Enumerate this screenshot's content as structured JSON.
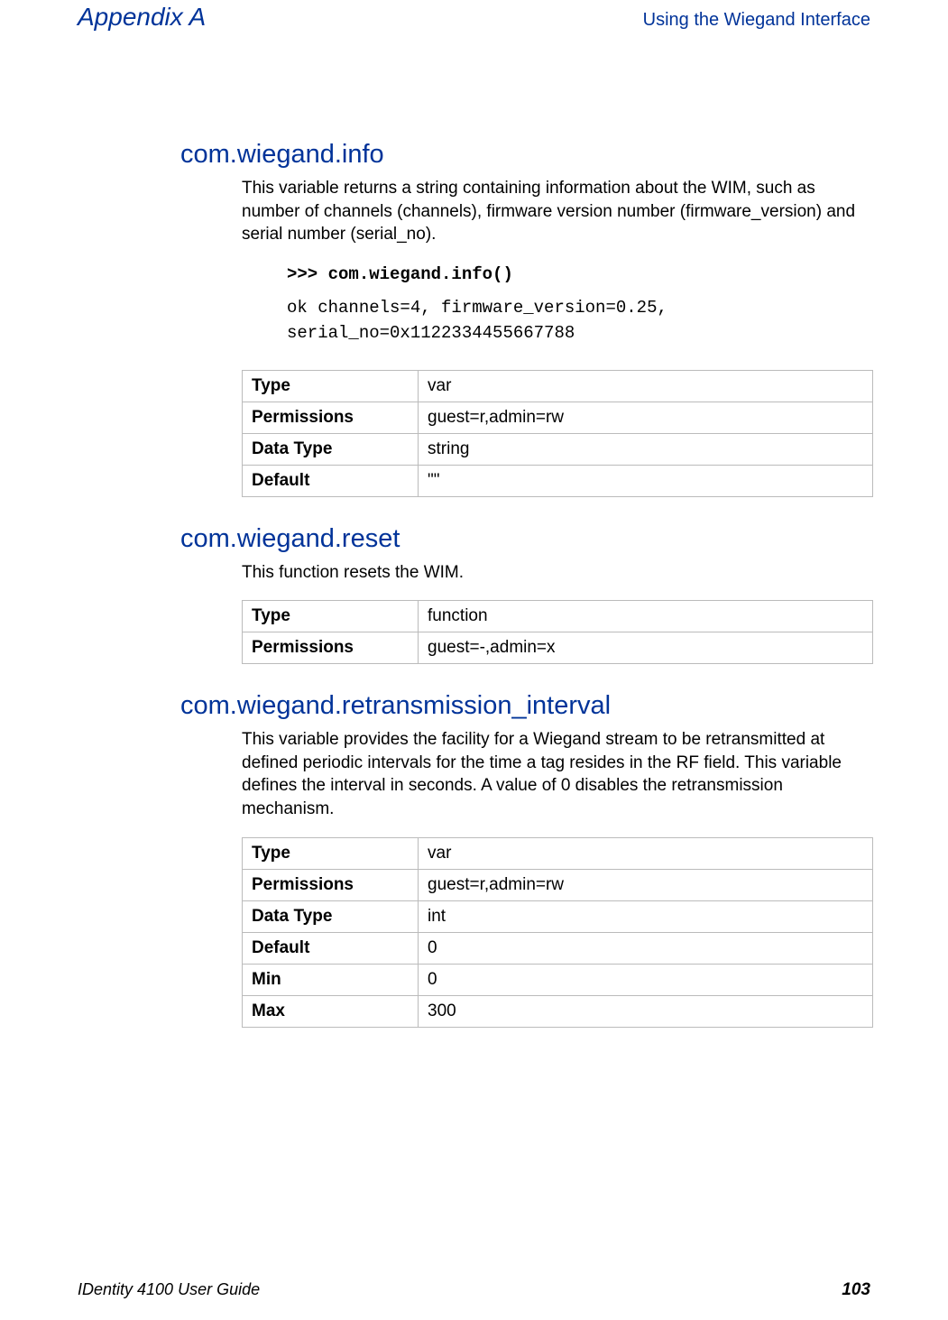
{
  "header": {
    "left": "Appendix A",
    "right": "Using the Wiegand Interface"
  },
  "sections": [
    {
      "heading": "com.wiegand.info",
      "body": "This variable returns a string containing information about the WIM, such as number of channels (channels), firmware version number (firmware_version) and serial number (serial_no).",
      "code_cmd": ">>> com.wiegand.info()",
      "code_out": "ok channels=4, firmware_version=0.25, serial_no=0x1122334455667788",
      "rows": [
        {
          "key": "Type",
          "val": "var"
        },
        {
          "key": "Permissions",
          "val": "guest=r,admin=rw"
        },
        {
          "key": "Data Type",
          "val": "string"
        },
        {
          "key": "Default",
          "val": "\"\""
        }
      ]
    },
    {
      "heading": "com.wiegand.reset",
      "body": "This function resets the WIM.",
      "rows": [
        {
          "key": "Type",
          "val": "function"
        },
        {
          "key": "Permissions",
          "val": "guest=-,admin=x"
        }
      ]
    },
    {
      "heading": "com.wiegand.retransmission_interval",
      "body": "This variable provides the facility for a Wiegand stream to be retransmitted at defined periodic intervals for the time a tag resides in the RF field. This variable defines the interval in seconds. A value of 0 disables the retransmission mechanism.",
      "rows": [
        {
          "key": "Type",
          "val": "var"
        },
        {
          "key": "Permissions",
          "val": "guest=r,admin=rw"
        },
        {
          "key": "Data Type",
          "val": "int"
        },
        {
          "key": "Default",
          "val": "0"
        },
        {
          "key": "Min",
          "val": "0"
        },
        {
          "key": "Max",
          "val": "300"
        }
      ]
    }
  ],
  "footer": {
    "left": "IDentity 4100 User Guide",
    "right": "103"
  }
}
